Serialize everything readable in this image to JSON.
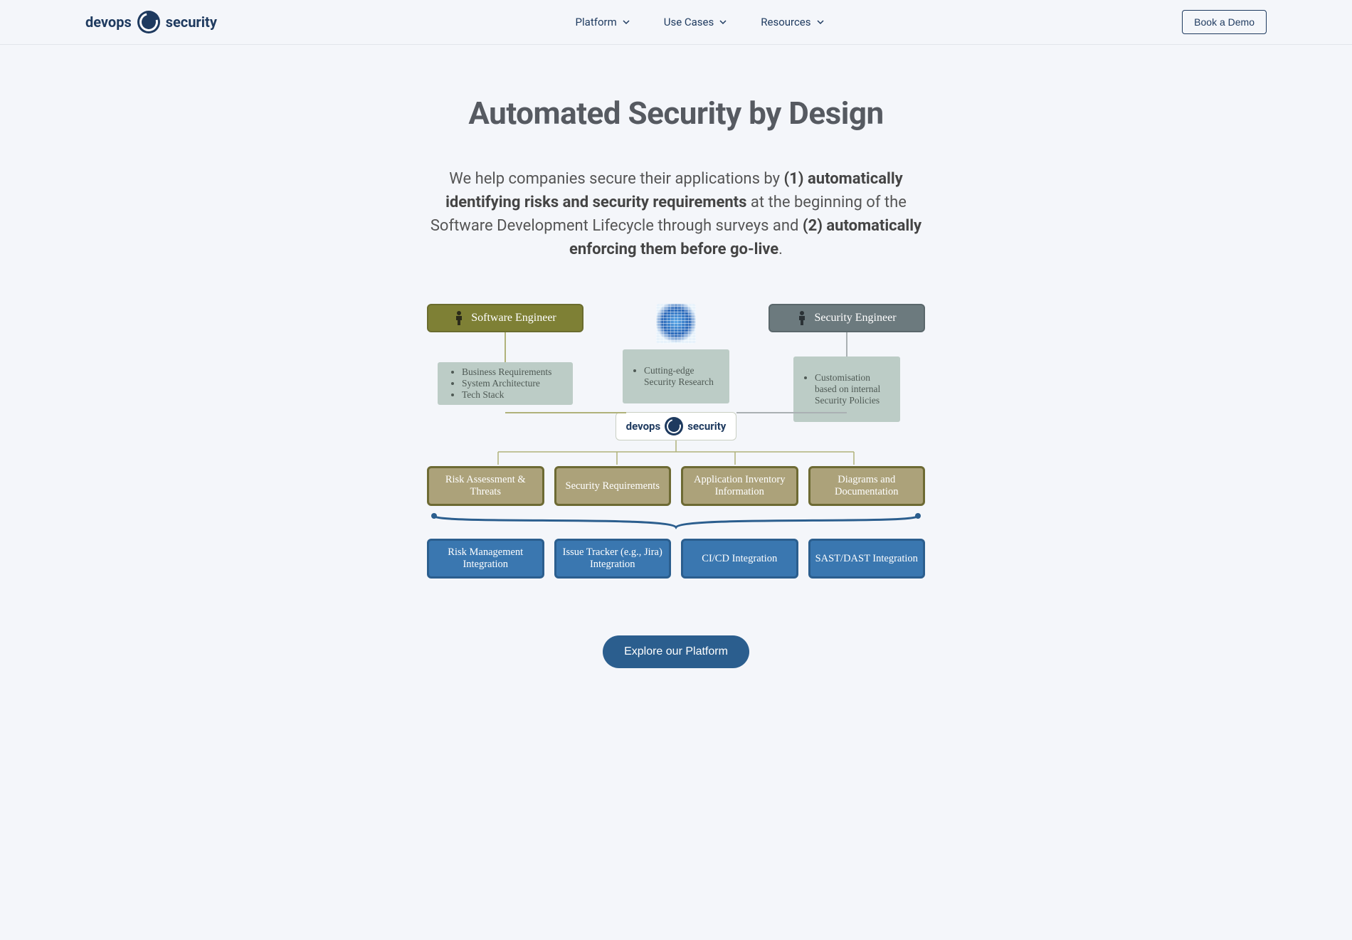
{
  "brand": {
    "name_left": "devops",
    "name_right": "security"
  },
  "nav": {
    "items": [
      {
        "label": "Platform"
      },
      {
        "label": "Use Cases"
      },
      {
        "label": "Resources"
      }
    ],
    "cta": "Book a Demo"
  },
  "hero": {
    "title": "Automated Security by Design",
    "p_lead": "We help companies secure their applications by ",
    "p_bold1": "(1) automatically identifying risks and security requirements",
    "p_mid": " at the beginning of the Software Development Lifecycle through surveys and ",
    "p_bold2": "(2) automatically enforcing them before go-live",
    "p_end": "."
  },
  "diagram": {
    "roles": {
      "software_engineer": "Software Engineer",
      "security_engineer": "Security Engineer"
    },
    "inputs": {
      "software_engineer_items": [
        "Business Requirements",
        "System Architecture",
        "Tech Stack"
      ],
      "research": "Cutting-edge\nSecurity Research",
      "security_engineer": "Customisation\nbased on internal\nSecurity Policies"
    },
    "hub": {
      "left": "devops",
      "right": "security"
    },
    "outputs": [
      "Risk Assessment & Threats",
      "Security Requirements",
      "Application Inventory Information",
      "Diagrams and Documentation"
    ],
    "integrations": [
      "Risk Management Integration",
      "Issue Tracker (e.g., Jira) Integration",
      "CI/CD Integration",
      "SAST/DAST Integration"
    ]
  },
  "cta": {
    "label": "Explore our Platform"
  },
  "colors": {
    "page_bg": "#f4f6fa",
    "brand_navy": "#1e3a5f",
    "olive": "#7e8035",
    "slate": "#6c7a7e",
    "desc_bg": "#bcccc6",
    "output_bg": "#aca27a",
    "output_border": "#6d6a33",
    "int_bg": "#3a77b0",
    "int_border": "#2b5e8e"
  }
}
